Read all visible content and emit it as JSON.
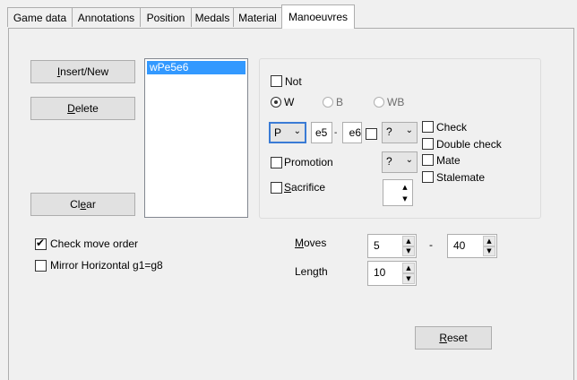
{
  "tabs": [
    {
      "label": "Game data"
    },
    {
      "label": "Annotations"
    },
    {
      "label": "Position"
    },
    {
      "label": "Medals"
    },
    {
      "label": "Material"
    },
    {
      "label": "Manoeuvres"
    }
  ],
  "buttons": {
    "insert_new": {
      "pre": "",
      "u": "I",
      "post": "nsert/New"
    },
    "delete": {
      "pre": "",
      "u": "D",
      "post": "elete"
    },
    "clear": {
      "pre": "Cl",
      "u": "e",
      "post": "ar"
    },
    "reset": {
      "pre": "",
      "u": "R",
      "post": "eset"
    }
  },
  "list": {
    "items": [
      "wPe5e6"
    ]
  },
  "criteria": {
    "not_label": "Not",
    "color_options": [
      "W",
      "B",
      "WB"
    ],
    "piece": "P",
    "from_square": "e5",
    "dash": "-",
    "to_square": "e6",
    "move_flag": "?",
    "promotion_label": "Promotion",
    "promotion_value": "?",
    "sacrifice": {
      "u": "S",
      "post": "acrifice"
    },
    "check_label": "Check",
    "double_check_label": "Double check",
    "mate_label": "Mate",
    "stalemate_label": "Stalemate"
  },
  "options": {
    "check_move_order_label": "Check move order",
    "mirror_horizontal_label": "Mirror Horizontal g1=g8"
  },
  "moves": {
    "label": {
      "pre": "",
      "u": "M",
      "post": "oves"
    },
    "from": "5",
    "dash": "-",
    "to": "40"
  },
  "length": {
    "label": {
      "pre": "Len",
      "u": "g",
      "post": "th"
    },
    "value": "10"
  }
}
